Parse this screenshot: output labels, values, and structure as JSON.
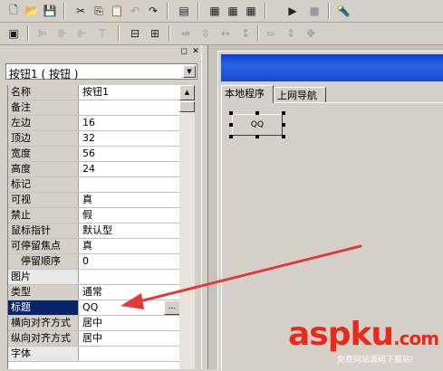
{
  "toolbar1": {
    "icons": [
      "new-icon",
      "open-icon",
      "save-icon",
      "cut-icon",
      "copy-icon",
      "paste-icon",
      "undo-icon",
      "redo-icon",
      "preview-icon",
      "layout1-icon",
      "layout2-icon",
      "layout3-icon",
      "run-icon",
      "stop-icon",
      "debug-icon"
    ]
  },
  "toolbar2": {
    "icons": [
      "form-icon",
      "align-left-icon",
      "align-center-icon",
      "align-right-icon",
      "align-top-icon",
      "align-middle-icon",
      "align-bottom-icon",
      "center-h-icon",
      "center-v-icon",
      "space-h-icon",
      "space-v-icon",
      "same-width-icon",
      "same-height-icon",
      "same-size-icon"
    ]
  },
  "panel": {
    "selector_value": "按钮1 ( 按钮 )",
    "properties": [
      {
        "name": "名称",
        "value": "按钮1"
      },
      {
        "name": "备注",
        "value": ""
      },
      {
        "name": "左边",
        "value": "16"
      },
      {
        "name": "顶边",
        "value": "32"
      },
      {
        "name": "宽度",
        "value": "56"
      },
      {
        "name": "高度",
        "value": "24"
      },
      {
        "name": "标记",
        "value": ""
      },
      {
        "name": "可视",
        "value": "真"
      },
      {
        "name": "禁止",
        "value": "假"
      },
      {
        "name": "鼠标指针",
        "value": "默认型"
      },
      {
        "name": "可停留焦点",
        "value": "真"
      },
      {
        "name": "停留顺序",
        "value": "0"
      },
      {
        "name": "图片",
        "value": ""
      },
      {
        "name": "类型",
        "value": "通常"
      },
      {
        "name": "标题",
        "value": "QQ"
      },
      {
        "name": "横向对齐方式",
        "value": "居中"
      },
      {
        "name": "纵向对齐方式",
        "value": "居中"
      },
      {
        "name": "字体",
        "value": ""
      }
    ],
    "ellipsis_label": "..."
  },
  "designer": {
    "tabs": [
      "本地程序",
      "上网导航"
    ],
    "button_label": "QQ"
  },
  "watermark": {
    "brand": "aspku",
    "domain": ".com",
    "sub": "免费网站源码下载站!"
  },
  "colors": {
    "selection": "#0a246a",
    "arrow": "#e03a3a",
    "titlebar": "#1848cc"
  }
}
